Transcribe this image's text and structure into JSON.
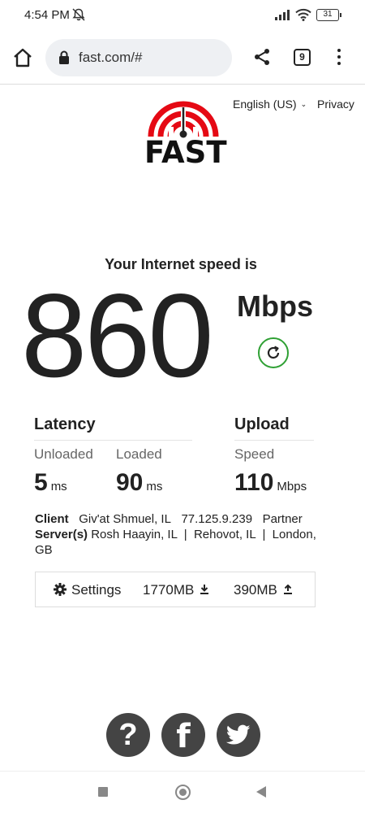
{
  "status_bar": {
    "time": "4:54 PM",
    "battery": "31"
  },
  "browser": {
    "url": "fast.com/#",
    "tab_count": "9"
  },
  "header": {
    "language": "English (US)",
    "privacy": "Privacy",
    "logo_text": "FAST"
  },
  "result": {
    "headline": "Your Internet speed is",
    "speed": "860",
    "units": "Mbps"
  },
  "latency": {
    "title": "Latency",
    "unloaded_label": "Unloaded",
    "unloaded_value": "5",
    "unloaded_unit": "ms",
    "loaded_label": "Loaded",
    "loaded_value": "90",
    "loaded_unit": "ms"
  },
  "upload": {
    "title": "Upload",
    "speed_label": "Speed",
    "speed_value": "110",
    "speed_unit": "Mbps"
  },
  "connection": {
    "client_label": "Client",
    "client_location": "Giv'at Shmuel, IL",
    "client_ip": "77.125.9.239",
    "client_isp": "Partner",
    "servers_label": "Server(s)",
    "servers_line1": "Rosh Haayin, IL  |  Rehovot, IL  |  London,",
    "servers_line2": "GB"
  },
  "settings_bar": {
    "settings_label": "Settings",
    "download_total": "1770MB",
    "upload_total": "390MB"
  },
  "social": {
    "help": "?",
    "facebook": "f"
  },
  "colors": {
    "accent_red": "#e50914",
    "refresh_green": "#2fa034",
    "text": "#222222",
    "social_bg": "#444444"
  },
  "icons": [
    "muted-bell-icon",
    "signal-icon",
    "wifi-icon",
    "battery-icon",
    "home-icon",
    "lock-icon",
    "share-icon",
    "tabs-icon",
    "more-icon",
    "chevron-down-icon",
    "refresh-icon",
    "gear-icon",
    "download-arrow-icon",
    "upload-arrow-icon",
    "help-icon",
    "facebook-icon",
    "twitter-icon"
  ]
}
